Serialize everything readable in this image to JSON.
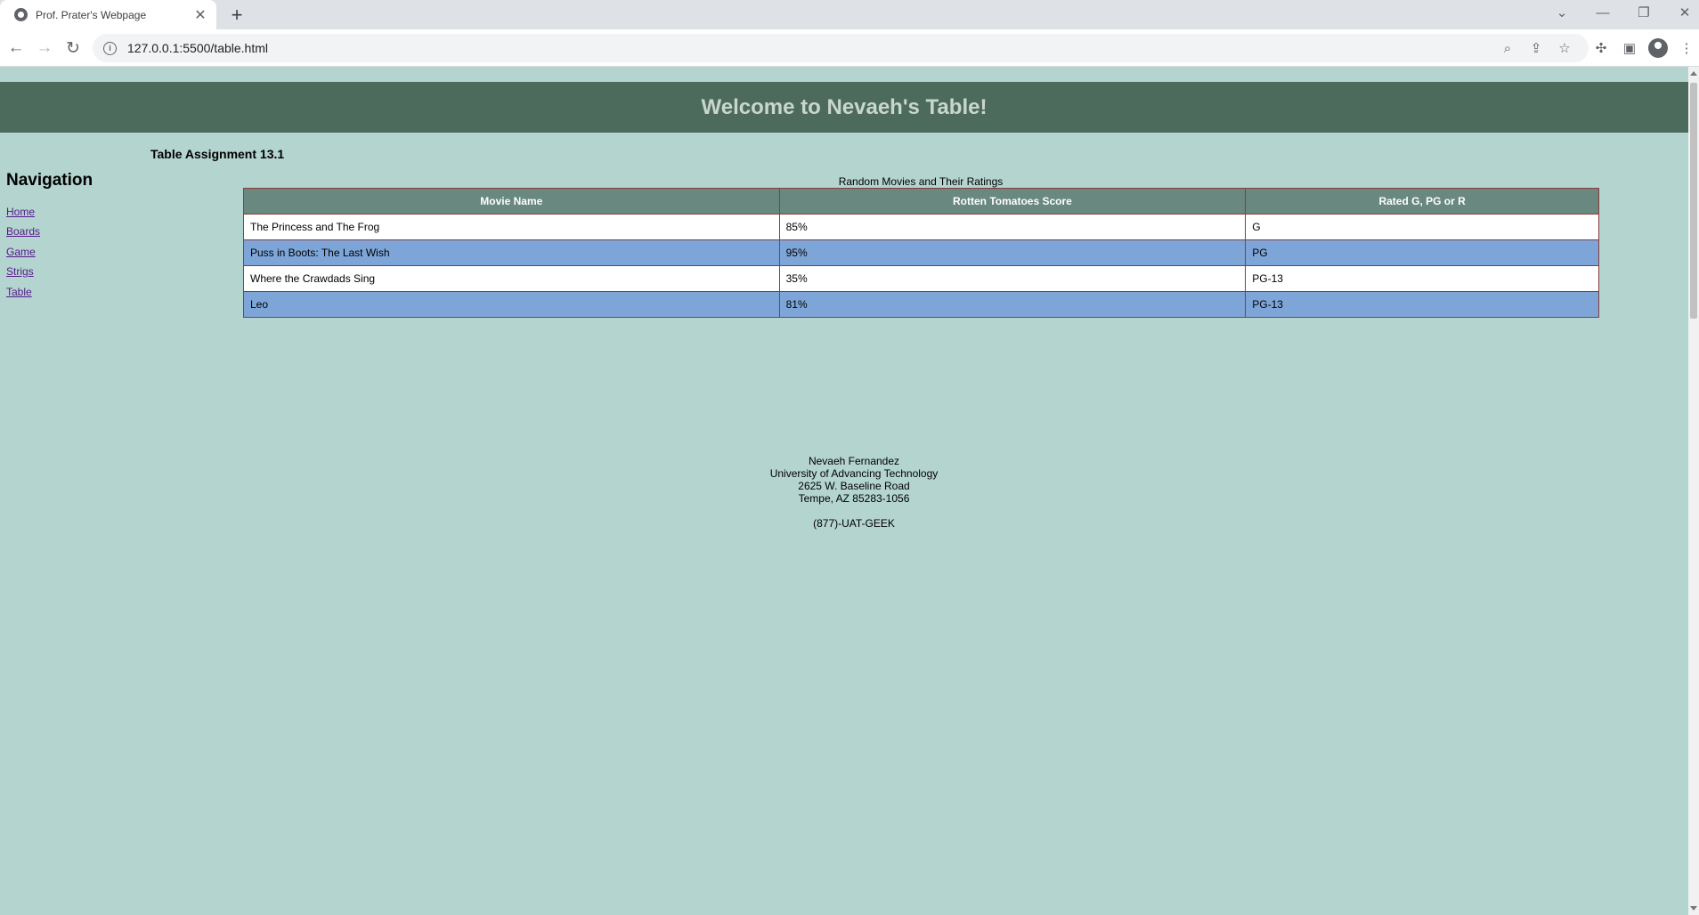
{
  "browser": {
    "tab_title": "Prof. Prater's Webpage",
    "url": "127.0.0.1:5500/table.html"
  },
  "page": {
    "banner_title": "Welcome to Nevaeh's Table!",
    "assignment_title": "Table Assignment 13.1",
    "navigation": {
      "heading": "Navigation",
      "links": [
        "Home",
        "Boards",
        "Game",
        "Strigs",
        "Table"
      ]
    },
    "table": {
      "caption": "Random Movies and Their Ratings",
      "headers": [
        "Movie Name",
        "Rotten Tomatoes Score",
        "Rated G, PG or R"
      ],
      "rows": [
        [
          "The Princess and The Frog",
          "85%",
          "G"
        ],
        [
          "Puss in Boots: The Last Wish",
          "95%",
          "PG"
        ],
        [
          "Where the Crawdads Sing",
          "35%",
          "PG-13"
        ],
        [
          "Leo",
          "81%",
          "PG-13"
        ]
      ]
    },
    "footer": {
      "name": "Nevaeh Fernandez",
      "school": "University of Advancing Technology",
      "street": "2625 W. Baseline Road",
      "city": "Tempe, AZ 85283-1056",
      "phone": "(877)-UAT-GEEK"
    }
  },
  "colors": {
    "page_background": "#b4d4cf",
    "banner_background": "#4d6b5d",
    "table_header": "#688880",
    "row_alt": "#7ea5d8"
  }
}
